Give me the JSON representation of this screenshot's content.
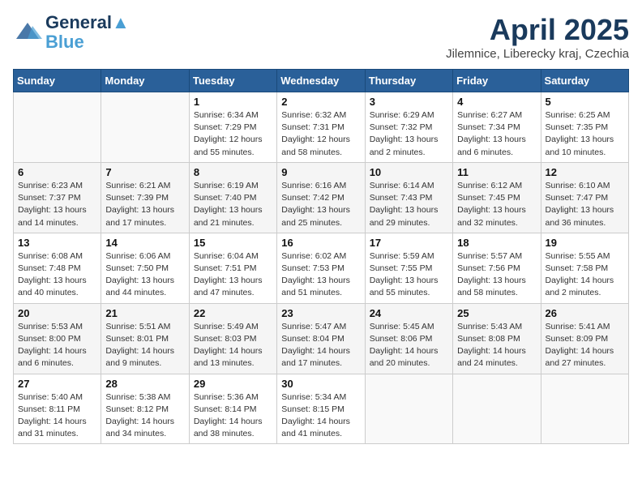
{
  "header": {
    "logo_line1": "General",
    "logo_line2": "Blue",
    "month_title": "April 2025",
    "location": "Jilemnice, Liberecky kraj, Czechia"
  },
  "days_of_week": [
    "Sunday",
    "Monday",
    "Tuesday",
    "Wednesday",
    "Thursday",
    "Friday",
    "Saturday"
  ],
  "weeks": [
    [
      {
        "day": "",
        "info": ""
      },
      {
        "day": "",
        "info": ""
      },
      {
        "day": "1",
        "info": "Sunrise: 6:34 AM\nSunset: 7:29 PM\nDaylight: 12 hours\nand 55 minutes."
      },
      {
        "day": "2",
        "info": "Sunrise: 6:32 AM\nSunset: 7:31 PM\nDaylight: 12 hours\nand 58 minutes."
      },
      {
        "day": "3",
        "info": "Sunrise: 6:29 AM\nSunset: 7:32 PM\nDaylight: 13 hours\nand 2 minutes."
      },
      {
        "day": "4",
        "info": "Sunrise: 6:27 AM\nSunset: 7:34 PM\nDaylight: 13 hours\nand 6 minutes."
      },
      {
        "day": "5",
        "info": "Sunrise: 6:25 AM\nSunset: 7:35 PM\nDaylight: 13 hours\nand 10 minutes."
      }
    ],
    [
      {
        "day": "6",
        "info": "Sunrise: 6:23 AM\nSunset: 7:37 PM\nDaylight: 13 hours\nand 14 minutes."
      },
      {
        "day": "7",
        "info": "Sunrise: 6:21 AM\nSunset: 7:39 PM\nDaylight: 13 hours\nand 17 minutes."
      },
      {
        "day": "8",
        "info": "Sunrise: 6:19 AM\nSunset: 7:40 PM\nDaylight: 13 hours\nand 21 minutes."
      },
      {
        "day": "9",
        "info": "Sunrise: 6:16 AM\nSunset: 7:42 PM\nDaylight: 13 hours\nand 25 minutes."
      },
      {
        "day": "10",
        "info": "Sunrise: 6:14 AM\nSunset: 7:43 PM\nDaylight: 13 hours\nand 29 minutes."
      },
      {
        "day": "11",
        "info": "Sunrise: 6:12 AM\nSunset: 7:45 PM\nDaylight: 13 hours\nand 32 minutes."
      },
      {
        "day": "12",
        "info": "Sunrise: 6:10 AM\nSunset: 7:47 PM\nDaylight: 13 hours\nand 36 minutes."
      }
    ],
    [
      {
        "day": "13",
        "info": "Sunrise: 6:08 AM\nSunset: 7:48 PM\nDaylight: 13 hours\nand 40 minutes."
      },
      {
        "day": "14",
        "info": "Sunrise: 6:06 AM\nSunset: 7:50 PM\nDaylight: 13 hours\nand 44 minutes."
      },
      {
        "day": "15",
        "info": "Sunrise: 6:04 AM\nSunset: 7:51 PM\nDaylight: 13 hours\nand 47 minutes."
      },
      {
        "day": "16",
        "info": "Sunrise: 6:02 AM\nSunset: 7:53 PM\nDaylight: 13 hours\nand 51 minutes."
      },
      {
        "day": "17",
        "info": "Sunrise: 5:59 AM\nSunset: 7:55 PM\nDaylight: 13 hours\nand 55 minutes."
      },
      {
        "day": "18",
        "info": "Sunrise: 5:57 AM\nSunset: 7:56 PM\nDaylight: 13 hours\nand 58 minutes."
      },
      {
        "day": "19",
        "info": "Sunrise: 5:55 AM\nSunset: 7:58 PM\nDaylight: 14 hours\nand 2 minutes."
      }
    ],
    [
      {
        "day": "20",
        "info": "Sunrise: 5:53 AM\nSunset: 8:00 PM\nDaylight: 14 hours\nand 6 minutes."
      },
      {
        "day": "21",
        "info": "Sunrise: 5:51 AM\nSunset: 8:01 PM\nDaylight: 14 hours\nand 9 minutes."
      },
      {
        "day": "22",
        "info": "Sunrise: 5:49 AM\nSunset: 8:03 PM\nDaylight: 14 hours\nand 13 minutes."
      },
      {
        "day": "23",
        "info": "Sunrise: 5:47 AM\nSunset: 8:04 PM\nDaylight: 14 hours\nand 17 minutes."
      },
      {
        "day": "24",
        "info": "Sunrise: 5:45 AM\nSunset: 8:06 PM\nDaylight: 14 hours\nand 20 minutes."
      },
      {
        "day": "25",
        "info": "Sunrise: 5:43 AM\nSunset: 8:08 PM\nDaylight: 14 hours\nand 24 minutes."
      },
      {
        "day": "26",
        "info": "Sunrise: 5:41 AM\nSunset: 8:09 PM\nDaylight: 14 hours\nand 27 minutes."
      }
    ],
    [
      {
        "day": "27",
        "info": "Sunrise: 5:40 AM\nSunset: 8:11 PM\nDaylight: 14 hours\nand 31 minutes."
      },
      {
        "day": "28",
        "info": "Sunrise: 5:38 AM\nSunset: 8:12 PM\nDaylight: 14 hours\nand 34 minutes."
      },
      {
        "day": "29",
        "info": "Sunrise: 5:36 AM\nSunset: 8:14 PM\nDaylight: 14 hours\nand 38 minutes."
      },
      {
        "day": "30",
        "info": "Sunrise: 5:34 AM\nSunset: 8:15 PM\nDaylight: 14 hours\nand 41 minutes."
      },
      {
        "day": "",
        "info": ""
      },
      {
        "day": "",
        "info": ""
      },
      {
        "day": "",
        "info": ""
      }
    ]
  ]
}
